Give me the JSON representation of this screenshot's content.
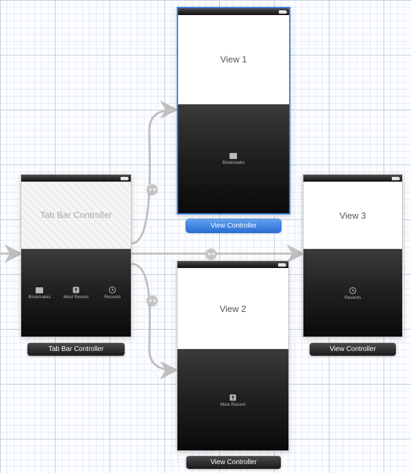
{
  "scenes": {
    "tab_bar_controller": {
      "title_text": "Tab Bar Controller",
      "label": "Tab Bar Controller",
      "selected": false,
      "tabs": [
        {
          "icon": "bookmarks",
          "label": "Bookmarks"
        },
        {
          "icon": "most-recent",
          "label": "Most Recent"
        },
        {
          "icon": "recents",
          "label": "Recents"
        }
      ]
    },
    "view1": {
      "body_text": "View 1",
      "label": "View Controller",
      "selected": true,
      "tab": {
        "icon": "bookmarks",
        "label": "Bookmarks"
      }
    },
    "view2": {
      "body_text": "View 2",
      "label": "View Controller",
      "selected": false,
      "tab": {
        "icon": "most-recent",
        "label": "Most Recent"
      }
    },
    "view3": {
      "body_text": "View 3",
      "label": "View Controller",
      "selected": false,
      "tab": {
        "icon": "recents",
        "label": "Recents"
      }
    }
  },
  "watermark": "www.AllPointsInBetween"
}
